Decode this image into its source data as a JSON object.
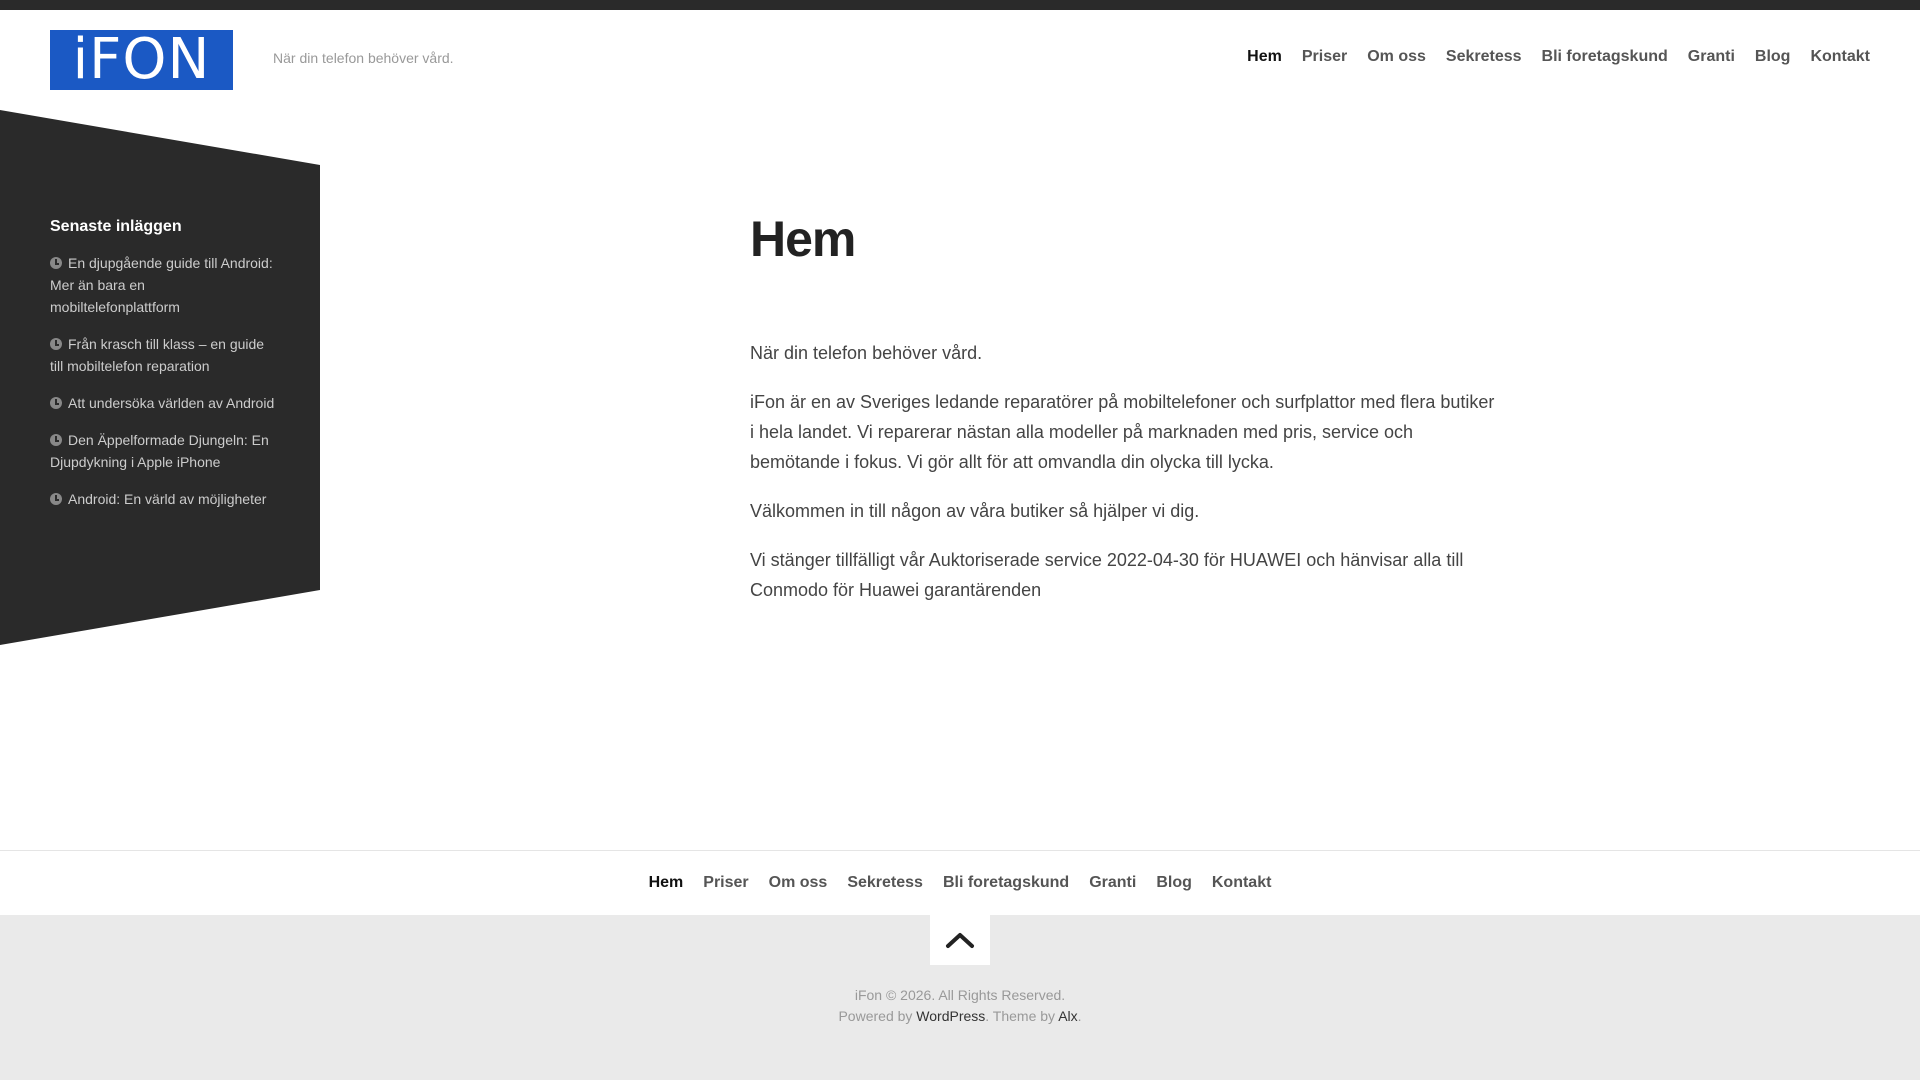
{
  "site": {
    "logo_text": "iFON",
    "tagline": "När din telefon behöver vård.",
    "brand_color": "#1b59c4"
  },
  "nav": {
    "items": [
      {
        "label": "Hem",
        "active": true
      },
      {
        "label": "Priser",
        "active": false
      },
      {
        "label": "Om oss",
        "active": false
      },
      {
        "label": "Sekretess",
        "active": false
      },
      {
        "label": "Bli foretagskund",
        "active": false
      },
      {
        "label": "Granti",
        "active": false
      },
      {
        "label": "Blog",
        "active": false
      },
      {
        "label": "Kontakt",
        "active": false
      }
    ]
  },
  "sidebar": {
    "title": "Senaste inläggen",
    "icon": "clock-icon",
    "posts": [
      "En djupgående guide till Android: Mer än bara en mobiltelefonplattform",
      "Från krasch till klass – en guide till mobiltelefon reparation",
      "Att undersöka världen av Android",
      "Den Äppelformade Djungeln: En Djupdykning i Apple iPhone",
      "Android: En värld av möjligheter"
    ]
  },
  "main": {
    "title": "Hem",
    "paragraphs": [
      "När din telefon behöver vård.",
      "iFon är en av Sveriges ledande reparatörer på mobiltelefoner och surfplattor med flera butiker i hela landet. Vi reparerar nästan alla modeller på marknaden med pris, service och bemötande i fokus. Vi gör allt för att omvandla din olycka till lycka.",
      "Välkommen in till någon av våra butiker så hjälper vi dig.",
      "Vi stänger tillfälligt vår Auktoriserade service 2022-04-30 för HUAWEI och hänvisar alla till Conmodo för Huawei garantärenden"
    ]
  },
  "footer": {
    "back_to_top_icon": "chevron-up-icon",
    "copyright": "iFon © 2026. All Rights Reserved.",
    "powered_prefix": "Powered by ",
    "powered_link": "WordPress",
    "theme_prefix": ". Theme by ",
    "theme_link": "Alx",
    "theme_suffix": "."
  }
}
